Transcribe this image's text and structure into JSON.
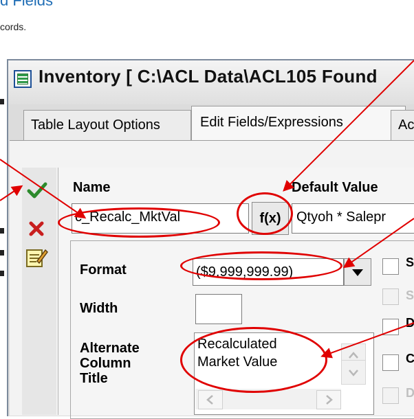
{
  "page": {
    "heading": "d Fields",
    "subtext": "cords."
  },
  "window": {
    "title": "Inventory [ C:\\ACL Data\\ACL105 Found",
    "tabs": [
      {
        "label": "Table Layout Options",
        "active": false
      },
      {
        "label": "Edit Fields/Expressions",
        "active": true
      },
      {
        "label": "Ac",
        "active": false
      }
    ]
  },
  "toolbar": {
    "accept_icon": "green-checkmark-icon",
    "delete_icon": "red-x-icon",
    "edit_icon": "notepad-edit-icon"
  },
  "form": {
    "name_label": "Name",
    "name_value": "c_Recalc_MktVal",
    "default_value_label": "Default Value",
    "fx_label": "f(x)",
    "default_value": "Qtyoh * Salepr",
    "format_label": "Format",
    "format_value": "($9,999,999.99)",
    "width_label": "Width",
    "width_value": "",
    "alternate_title_label_1": "Alternate",
    "alternate_title_label_2": "Column",
    "alternate_title_label_3": "Title",
    "alternate_title_line_1": "Recalculated",
    "alternate_title_line_2": "Market Value",
    "checkbox_labels": [
      "S",
      "S",
      "D",
      "C",
      "D"
    ]
  },
  "colors": {
    "annotation": "#e00000",
    "accent": "#1f6db5"
  }
}
